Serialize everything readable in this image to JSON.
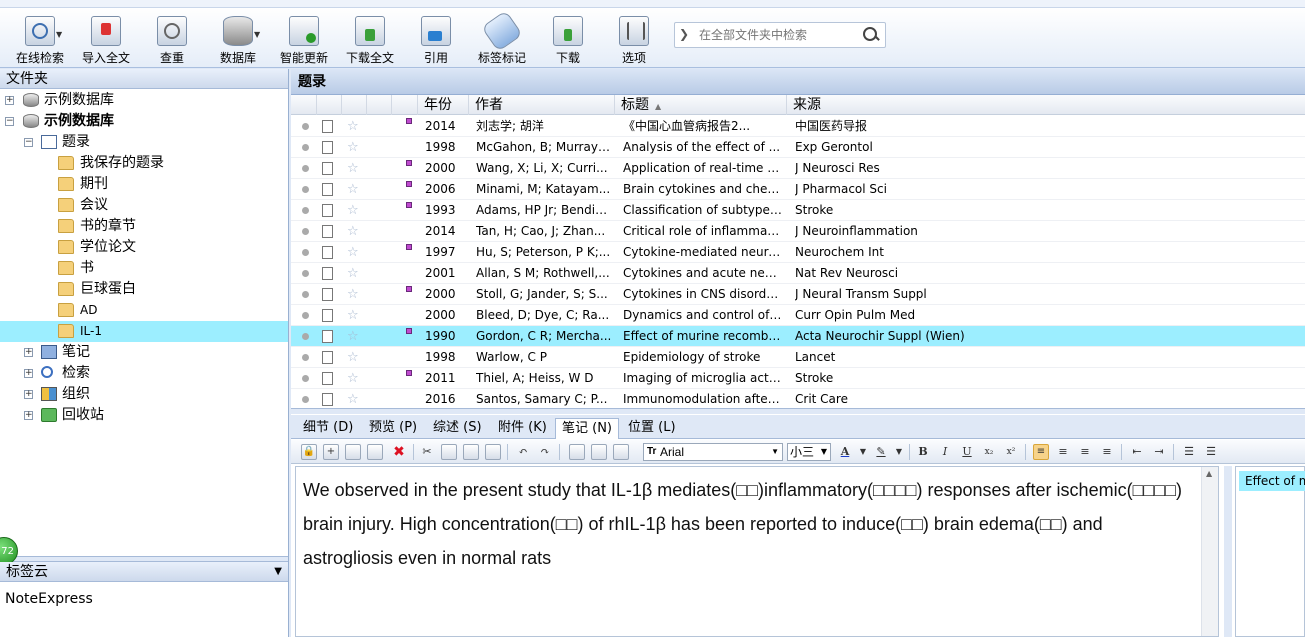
{
  "toolbar": {
    "buttons": [
      {
        "label": "在线检索",
        "icon": "online-search-icon"
      },
      {
        "label": "导入全文",
        "icon": "import-pdf-icon"
      },
      {
        "label": "查重",
        "icon": "duplicate-check-icon"
      },
      {
        "label": "数据库",
        "icon": "database-icon"
      },
      {
        "label": "智能更新",
        "icon": "smart-update-icon"
      },
      {
        "label": "下载全文",
        "icon": "download-fulltext-icon"
      },
      {
        "label": "引用",
        "icon": "cite-icon"
      },
      {
        "label": "标签标记",
        "icon": "tag-icon"
      },
      {
        "label": "下载",
        "icon": "download-icon"
      },
      {
        "label": "选项",
        "icon": "options-icon"
      }
    ],
    "search_placeholder": "在全部文件夹中检索"
  },
  "folders": {
    "title": "文件夹",
    "items": [
      {
        "label": "示例数据库",
        "icon": "database-icon",
        "exp": "+",
        "bold": false
      },
      {
        "label": "示例数据库",
        "icon": "database-icon",
        "exp": "-",
        "bold": true
      },
      {
        "label": "题录",
        "icon": "list-icon",
        "exp": "-",
        "bold": false
      },
      {
        "label": "我保存的题录",
        "icon": "folder-icon"
      },
      {
        "label": "期刊",
        "icon": "folder-icon"
      },
      {
        "label": "会议",
        "icon": "folder-icon"
      },
      {
        "label": "书的章节",
        "icon": "folder-icon"
      },
      {
        "label": "学位论文",
        "icon": "folder-icon"
      },
      {
        "label": "书",
        "icon": "folder-icon"
      },
      {
        "label": "巨球蛋白",
        "icon": "folder-icon"
      },
      {
        "label": "AD",
        "icon": "folder-icon"
      },
      {
        "label": "IL-1",
        "icon": "folder-icon",
        "selected": true
      },
      {
        "label": "笔记",
        "icon": "notes-icon",
        "exp": "+"
      },
      {
        "label": "检索",
        "icon": "search-icon",
        "exp": "+"
      },
      {
        "label": "组织",
        "icon": "organize-icon",
        "exp": "+"
      },
      {
        "label": "回收站",
        "icon": "recycle-bin-icon",
        "exp": "+"
      }
    ]
  },
  "tagcloud": {
    "title": "标签云",
    "item": "NoteExpress",
    "badge": "72"
  },
  "records": {
    "title": "题录",
    "columns": {
      "year": "年份",
      "author": "作者",
      "title": "标题",
      "source": "来源"
    },
    "sorted_column": "title",
    "sort_direction": "ascending",
    "rows": [
      {
        "year": "2014",
        "author": "刘志学; 胡洋",
        "title": "《中国心血管病报告2...",
        "source": "中国医药导报",
        "att": true
      },
      {
        "year": "1998",
        "author": "McGahon, B; Murray,...",
        "title": "Analysis of the effect of ...",
        "source": "Exp Gerontol",
        "att": false
      },
      {
        "year": "2000",
        "author": "Wang, X; Li, X; Curri...",
        "title": "Application of real-time p...",
        "source": "J Neurosci Res",
        "att": true
      },
      {
        "year": "2006",
        "author": "Minami, M; Katayam...",
        "title": "Brain cytokines and chem...",
        "source": "J Pharmacol Sci",
        "att": true
      },
      {
        "year": "1993",
        "author": "Adams, HP Jr; Bendix...",
        "title": "Classification of subtype ...",
        "source": "Stroke",
        "att": true
      },
      {
        "year": "2014",
        "author": "Tan, H; Cao, J; Zhan...",
        "title": "Critical role of inflammat...",
        "source": "J Neuroinflammation",
        "att": false
      },
      {
        "year": "1997",
        "author": "Hu, S; Peterson, P K;...",
        "title": "Cytokine-mediated neuro...",
        "source": "Neurochem Int",
        "att": true
      },
      {
        "year": "2001",
        "author": "Allan, S M; Rothwell,...",
        "title": "Cytokines and acute neur...",
        "source": "Nat Rev Neurosci",
        "att": false
      },
      {
        "year": "2000",
        "author": "Stoll, G; Jander, S; S...",
        "title": "Cytokines in CNS disorder...",
        "source": "J Neural Transm Suppl",
        "att": true
      },
      {
        "year": "2000",
        "author": "Bleed, D; Dye, C; Ra...",
        "title": "Dynamics and control of t...",
        "source": "Curr Opin Pulm Med",
        "att": false
      },
      {
        "year": "1990",
        "author": "Gordon, C R; Mercha...",
        "title": "Effect of murine recombi...",
        "source": "Acta Neurochir Suppl (Wien)",
        "att": true,
        "selected": true
      },
      {
        "year": "1998",
        "author": "Warlow, C P",
        "title": "Epidemiology of stroke",
        "source": "Lancet",
        "att": false
      },
      {
        "year": "2011",
        "author": "Thiel, A; Heiss, W D",
        "title": "Imaging of microglia activ...",
        "source": "Stroke",
        "att": true
      },
      {
        "year": "2016",
        "author": "Santos, Samary C; P...",
        "title": "Immunomodulation after ...",
        "source": "Crit Care",
        "att": false
      }
    ]
  },
  "tabs": [
    {
      "label": "细节 (D)",
      "active": false
    },
    {
      "label": "预览 (P)",
      "active": false
    },
    {
      "label": "综述 (S)",
      "active": false
    },
    {
      "label": "附件 (K)",
      "active": false
    },
    {
      "label": "笔记 (N)",
      "active": true
    },
    {
      "label": "位置 (L)",
      "active": false
    }
  ],
  "editor": {
    "font": "Arial",
    "size": "小三",
    "text": "We observed in the present study that IL-1β mediates(□□)inflammatory(□□□□) responses after ischemic(□□□□) brain injury. High concentration(□□) of rhIL-1β has been reported to induce(□□) brain edema(□□) and astrogliosis even in normal rats",
    "side_panel_text": "Effect of m"
  },
  "colors": {
    "selection": "#9ceeff",
    "attachment_marker": "#c04ad0"
  }
}
